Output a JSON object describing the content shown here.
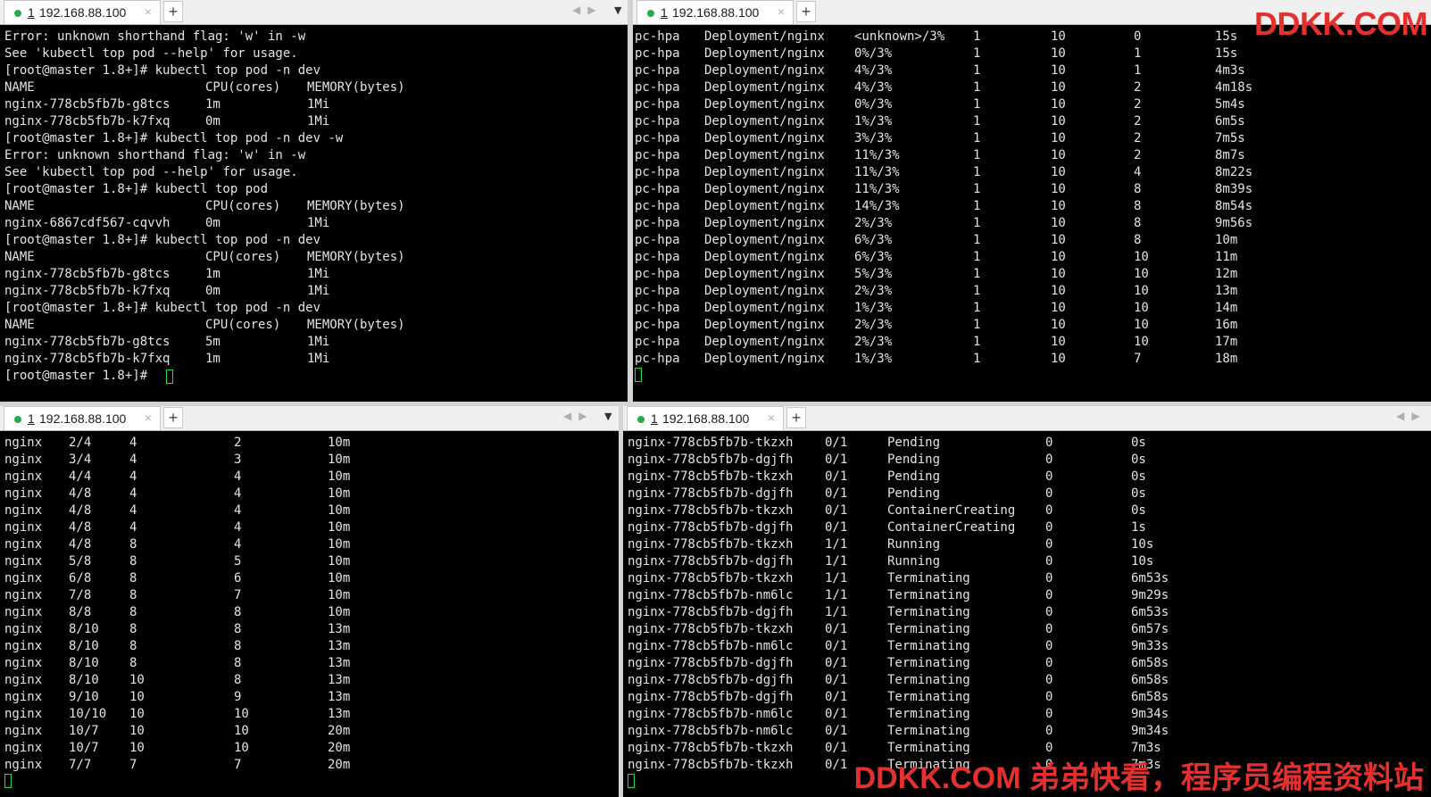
{
  "tabs": {
    "tl": {
      "num": "1",
      "host": "192.168.88.100",
      "close": "×",
      "add": "+"
    },
    "tr": {
      "num": "1",
      "host": "192.168.88.100",
      "close": "×",
      "add": "+"
    },
    "bl": {
      "num": "1",
      "host": "192.168.88.100",
      "close": "×",
      "add": "+"
    },
    "br": {
      "num": "1",
      "host": "192.168.88.100",
      "close": "×",
      "add": "+"
    }
  },
  "colors": {
    "accent": "#2aa84a",
    "terminal_bg": "#000000",
    "terminal_fg": "#e4e4e4",
    "watermark": "#e53030"
  },
  "top_left": [
    [
      "Error: unknown shorthand flag: 'w' in -w"
    ],
    [
      "See 'kubectl top pod --help' for usage."
    ],
    [
      "[root@master 1.8+]# kubectl top pod -n dev"
    ],
    [
      "NAME",
      "CPU(cores)",
      "MEMORY(bytes)"
    ],
    [
      "nginx-778cb5fb7b-g8tcs",
      "1m",
      "1Mi"
    ],
    [
      "nginx-778cb5fb7b-k7fxq",
      "0m",
      "1Mi"
    ],
    [
      "[root@master 1.8+]# kubectl top pod -n dev -w"
    ],
    [
      "Error: unknown shorthand flag: 'w' in -w"
    ],
    [
      "See 'kubectl top pod --help' for usage."
    ],
    [
      "[root@master 1.8+]# kubectl top pod"
    ],
    [
      "NAME",
      "CPU(cores)",
      "MEMORY(bytes)"
    ],
    [
      "nginx-6867cdf567-cqvvh",
      "0m",
      "1Mi"
    ],
    [
      "[root@master 1.8+]# kubectl top pod -n dev"
    ],
    [
      "NAME",
      "CPU(cores)",
      "MEMORY(bytes)"
    ],
    [
      "nginx-778cb5fb7b-g8tcs",
      "1m",
      "1Mi"
    ],
    [
      "nginx-778cb5fb7b-k7fxq",
      "0m",
      "1Mi"
    ],
    [
      "[root@master 1.8+]# kubectl top pod -n dev"
    ],
    [
      "NAME",
      "CPU(cores)",
      "MEMORY(bytes)"
    ],
    [
      "nginx-778cb5fb7b-g8tcs",
      "5m",
      "1Mi"
    ],
    [
      "nginx-778cb5fb7b-k7fxq",
      "1m",
      "1Mi"
    ],
    [
      "[root@master 1.8+]# "
    ]
  ],
  "top_right": [
    [
      "pc-hpa",
      "Deployment/nginx",
      "<unknown>/3%",
      "1",
      "10",
      "0",
      "15s"
    ],
    [
      "pc-hpa",
      "Deployment/nginx",
      "0%/3%",
      "1",
      "10",
      "1",
      "15s"
    ],
    [
      "pc-hpa",
      "Deployment/nginx",
      "4%/3%",
      "1",
      "10",
      "1",
      "4m3s"
    ],
    [
      "pc-hpa",
      "Deployment/nginx",
      "4%/3%",
      "1",
      "10",
      "2",
      "4m18s"
    ],
    [
      "pc-hpa",
      "Deployment/nginx",
      "0%/3%",
      "1",
      "10",
      "2",
      "5m4s"
    ],
    [
      "pc-hpa",
      "Deployment/nginx",
      "1%/3%",
      "1",
      "10",
      "2",
      "6m5s"
    ],
    [
      "pc-hpa",
      "Deployment/nginx",
      "3%/3%",
      "1",
      "10",
      "2",
      "7m5s"
    ],
    [
      "pc-hpa",
      "Deployment/nginx",
      "11%/3%",
      "1",
      "10",
      "2",
      "8m7s"
    ],
    [
      "pc-hpa",
      "Deployment/nginx",
      "11%/3%",
      "1",
      "10",
      "4",
      "8m22s"
    ],
    [
      "pc-hpa",
      "Deployment/nginx",
      "11%/3%",
      "1",
      "10",
      "8",
      "8m39s"
    ],
    [
      "pc-hpa",
      "Deployment/nginx",
      "14%/3%",
      "1",
      "10",
      "8",
      "8m54s"
    ],
    [
      "pc-hpa",
      "Deployment/nginx",
      "2%/3%",
      "1",
      "10",
      "8",
      "9m56s"
    ],
    [
      "pc-hpa",
      "Deployment/nginx",
      "6%/3%",
      "1",
      "10",
      "8",
      "10m"
    ],
    [
      "pc-hpa",
      "Deployment/nginx",
      "6%/3%",
      "1",
      "10",
      "10",
      "11m"
    ],
    [
      "pc-hpa",
      "Deployment/nginx",
      "5%/3%",
      "1",
      "10",
      "10",
      "12m"
    ],
    [
      "pc-hpa",
      "Deployment/nginx",
      "2%/3%",
      "1",
      "10",
      "10",
      "13m"
    ],
    [
      "pc-hpa",
      "Deployment/nginx",
      "1%/3%",
      "1",
      "10",
      "10",
      "14m"
    ],
    [
      "pc-hpa",
      "Deployment/nginx",
      "2%/3%",
      "1",
      "10",
      "10",
      "16m"
    ],
    [
      "pc-hpa",
      "Deployment/nginx",
      "2%/3%",
      "1",
      "10",
      "10",
      "17m"
    ],
    [
      "pc-hpa",
      "Deployment/nginx",
      "1%/3%",
      "1",
      "10",
      "7",
      "18m"
    ]
  ],
  "bottom_left": [
    [
      "nginx",
      "2/4",
      "4",
      "2",
      "10m"
    ],
    [
      "nginx",
      "3/4",
      "4",
      "3",
      "10m"
    ],
    [
      "nginx",
      "4/4",
      "4",
      "4",
      "10m"
    ],
    [
      "nginx",
      "4/8",
      "4",
      "4",
      "10m"
    ],
    [
      "nginx",
      "4/8",
      "4",
      "4",
      "10m"
    ],
    [
      "nginx",
      "4/8",
      "4",
      "4",
      "10m"
    ],
    [
      "nginx",
      "4/8",
      "8",
      "4",
      "10m"
    ],
    [
      "nginx",
      "5/8",
      "8",
      "5",
      "10m"
    ],
    [
      "nginx",
      "6/8",
      "8",
      "6",
      "10m"
    ],
    [
      "nginx",
      "7/8",
      "8",
      "7",
      "10m"
    ],
    [
      "nginx",
      "8/8",
      "8",
      "8",
      "10m"
    ],
    [
      "nginx",
      "8/10",
      "8",
      "8",
      "13m"
    ],
    [
      "nginx",
      "8/10",
      "8",
      "8",
      "13m"
    ],
    [
      "nginx",
      "8/10",
      "8",
      "8",
      "13m"
    ],
    [
      "nginx",
      "8/10",
      "10",
      "8",
      "13m"
    ],
    [
      "nginx",
      "9/10",
      "10",
      "9",
      "13m"
    ],
    [
      "nginx",
      "10/10",
      "10",
      "10",
      "13m"
    ],
    [
      "nginx",
      "10/7",
      "10",
      "10",
      "20m"
    ],
    [
      "nginx",
      "10/7",
      "10",
      "10",
      "20m"
    ],
    [
      "nginx",
      "7/7",
      "7",
      "7",
      "20m"
    ]
  ],
  "bottom_right": [
    [
      "nginx-778cb5fb7b-tkzxh",
      "0/1",
      "Pending",
      "0",
      "0s"
    ],
    [
      "nginx-778cb5fb7b-dgjfh",
      "0/1",
      "Pending",
      "0",
      "0s"
    ],
    [
      "nginx-778cb5fb7b-tkzxh",
      "0/1",
      "Pending",
      "0",
      "0s"
    ],
    [
      "nginx-778cb5fb7b-dgjfh",
      "0/1",
      "Pending",
      "0",
      "0s"
    ],
    [
      "nginx-778cb5fb7b-tkzxh",
      "0/1",
      "ContainerCreating",
      "0",
      "0s"
    ],
    [
      "nginx-778cb5fb7b-dgjfh",
      "0/1",
      "ContainerCreating",
      "0",
      "1s"
    ],
    [
      "nginx-778cb5fb7b-tkzxh",
      "1/1",
      "Running",
      "0",
      "10s"
    ],
    [
      "nginx-778cb5fb7b-dgjfh",
      "1/1",
      "Running",
      "0",
      "10s"
    ],
    [
      "nginx-778cb5fb7b-tkzxh",
      "1/1",
      "Terminating",
      "0",
      "6m53s"
    ],
    [
      "nginx-778cb5fb7b-nm6lc",
      "1/1",
      "Terminating",
      "0",
      "9m29s"
    ],
    [
      "nginx-778cb5fb7b-dgjfh",
      "1/1",
      "Terminating",
      "0",
      "6m53s"
    ],
    [
      "nginx-778cb5fb7b-tkzxh",
      "0/1",
      "Terminating",
      "0",
      "6m57s"
    ],
    [
      "nginx-778cb5fb7b-nm6lc",
      "0/1",
      "Terminating",
      "0",
      "9m33s"
    ],
    [
      "nginx-778cb5fb7b-dgjfh",
      "0/1",
      "Terminating",
      "0",
      "6m58s"
    ],
    [
      "nginx-778cb5fb7b-dgjfh",
      "0/1",
      "Terminating",
      "0",
      "6m58s"
    ],
    [
      "nginx-778cb5fb7b-dgjfh",
      "0/1",
      "Terminating",
      "0",
      "6m58s"
    ],
    [
      "nginx-778cb5fb7b-nm6lc",
      "0/1",
      "Terminating",
      "0",
      "9m34s"
    ],
    [
      "nginx-778cb5fb7b-nm6lc",
      "0/1",
      "Terminating",
      "0",
      "9m34s"
    ],
    [
      "nginx-778cb5fb7b-tkzxh",
      "0/1",
      "Terminating",
      "0",
      "7m3s"
    ],
    [
      "nginx-778cb5fb7b-tkzxh",
      "0/1",
      "Terminating",
      "0",
      "7m3s"
    ]
  ],
  "watermark": {
    "top": "DDKK.COM",
    "bottom": "DDKK.COM 弟弟快看，程序员编程资料站"
  }
}
